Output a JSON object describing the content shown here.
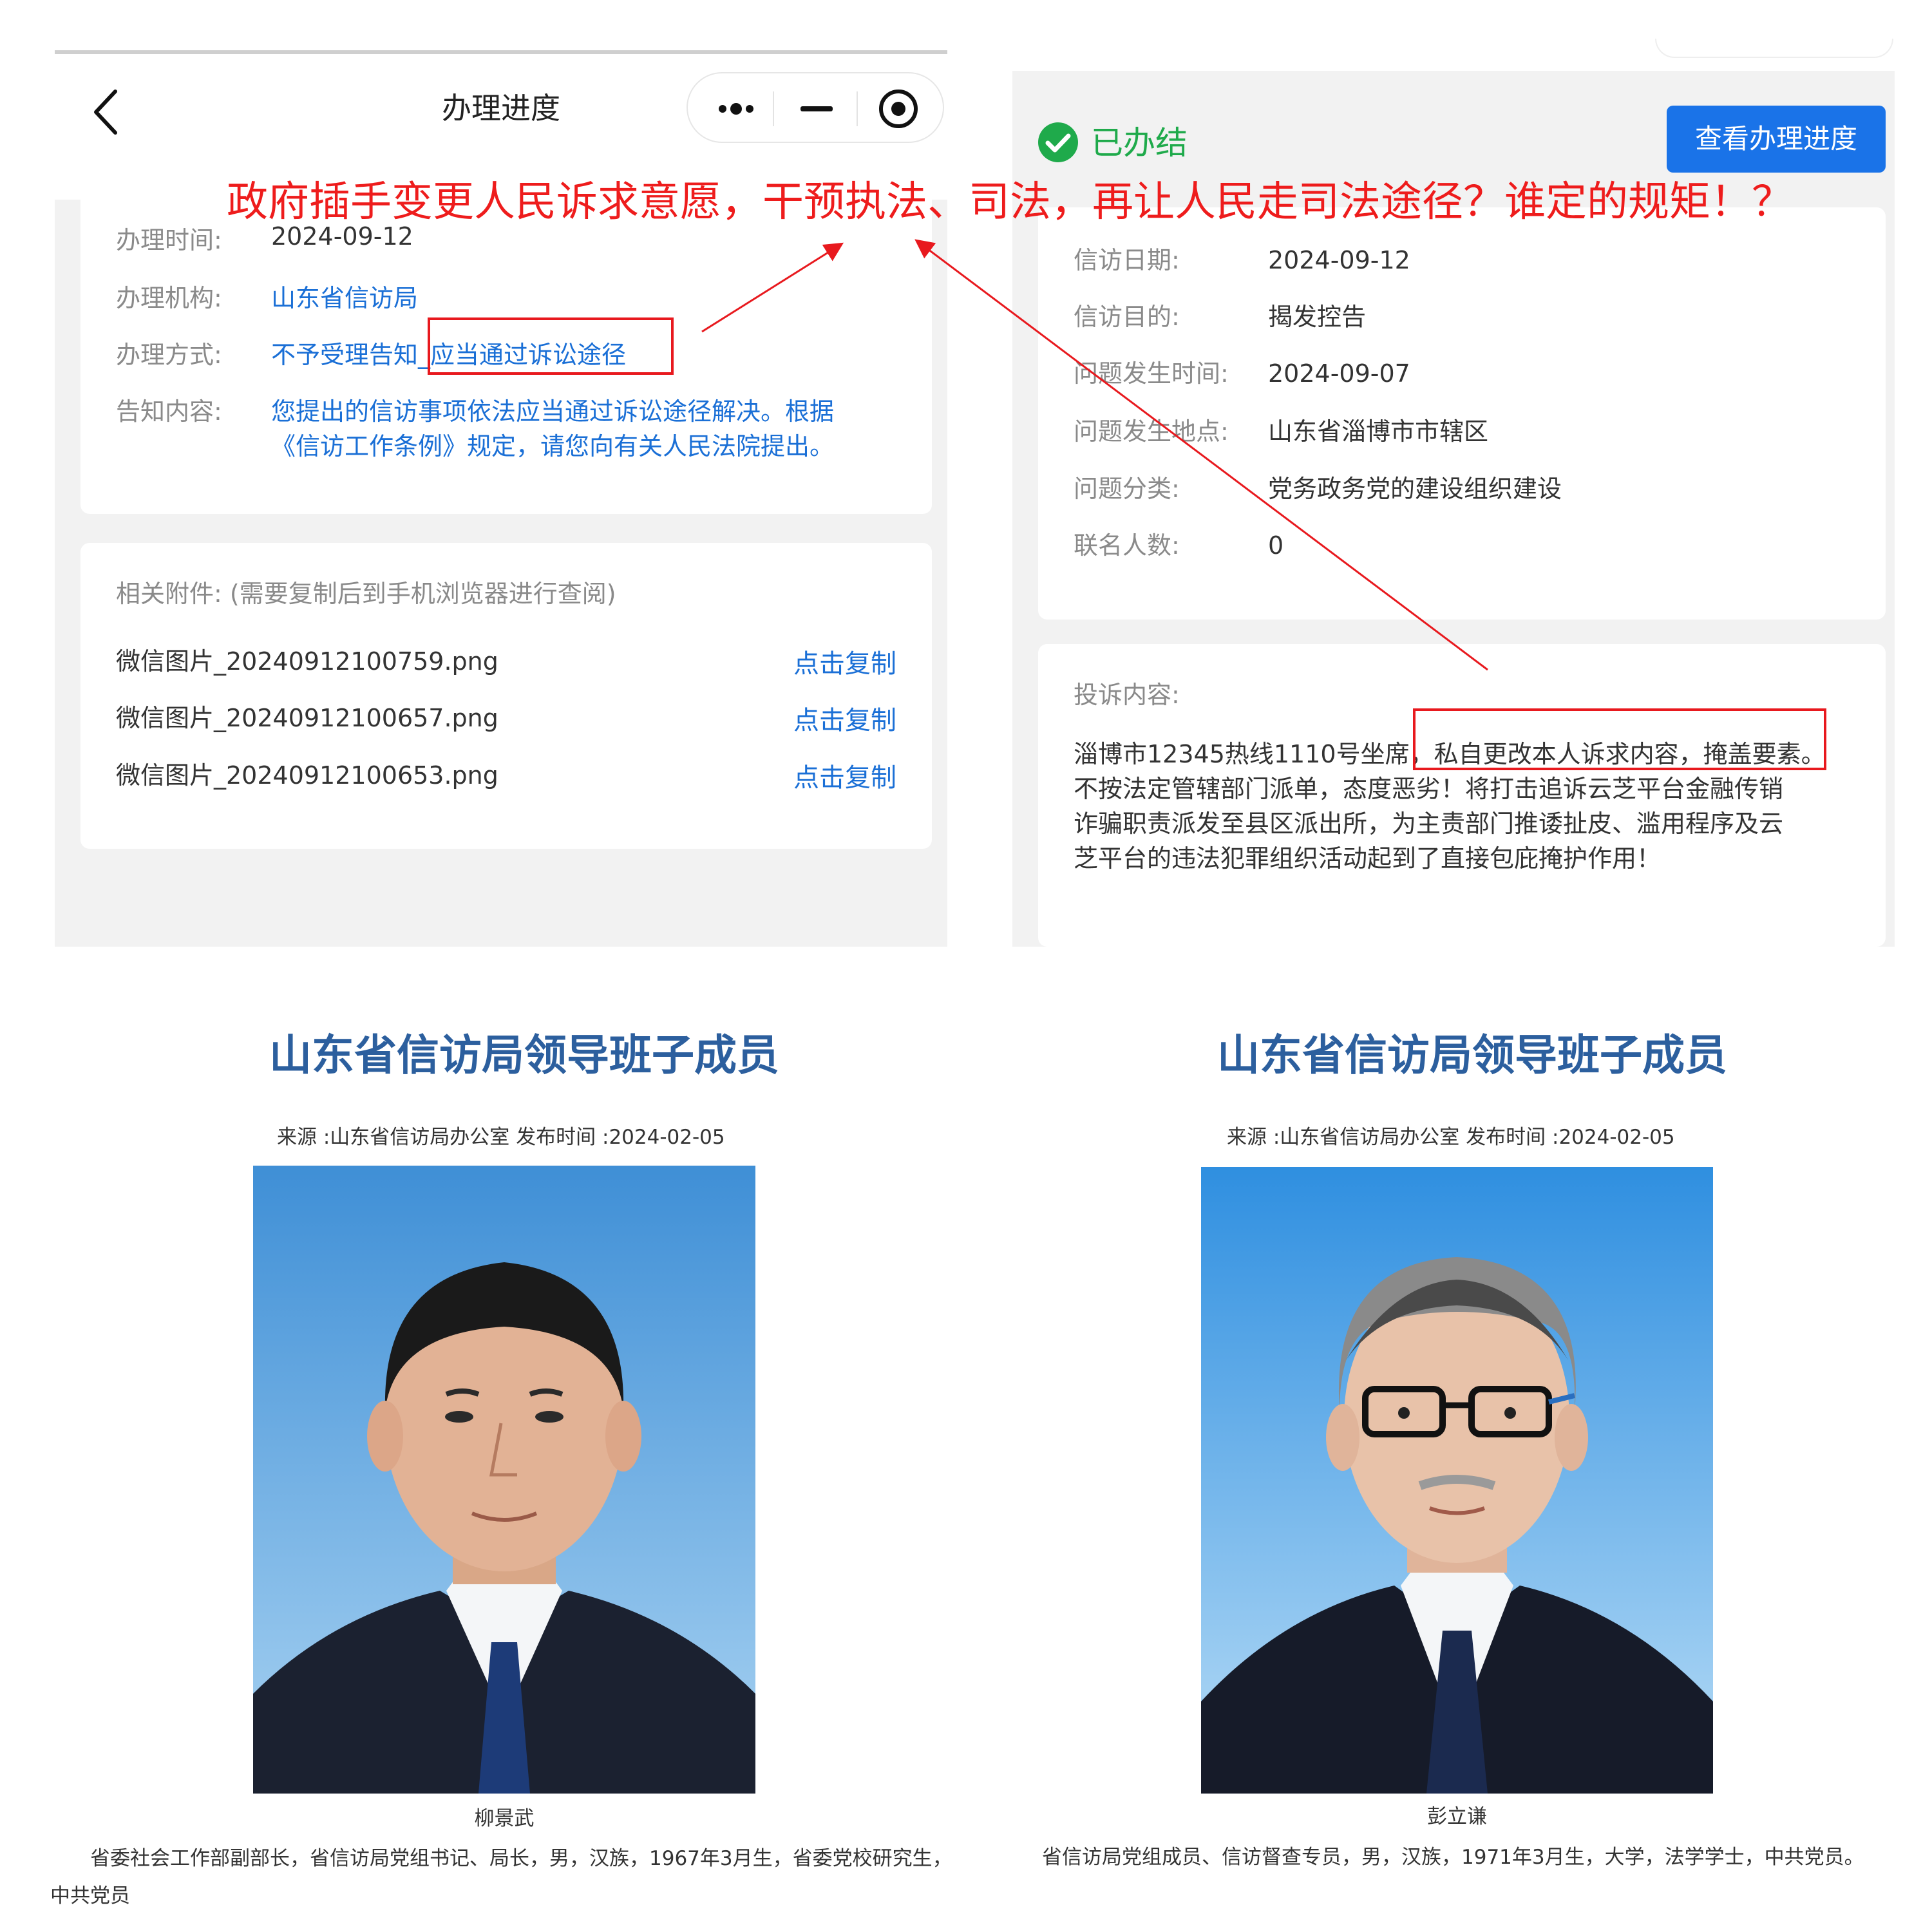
{
  "annotation": {
    "text": "政府插手变更人民诉求意愿，干预执法、司法，再让人民走司法途径？谁定的规矩！？"
  },
  "left_phone": {
    "nav_title": "办理进度",
    "process": {
      "time_label": "办理时间:",
      "time_value": "2024-09-12",
      "org_label": "办理机构:",
      "org_value": "山东省信访局",
      "method_label": "办理方式:",
      "method_value_prefix": "不予受理告知",
      "method_value_highlight": "_应当通过诉讼途径",
      "notice_label": "告知内容:",
      "notice_line1": "您提出的信访事项依法应当通过诉讼途径解决。根据",
      "notice_line2": "《信访工作条例》规定，请您向有关人民法院提出。"
    },
    "attachments": {
      "header": "相关附件:  (需要复制后到手机浏览器进行查阅)",
      "copy_label": "点击复制",
      "files": [
        "微信图片_20240912100759.png",
        "微信图片_20240912100657.png",
        "微信图片_20240912100653.png"
      ]
    }
  },
  "right_phone": {
    "status": "已办结",
    "view_progress_button": "查看办理进度",
    "petition": {
      "date_label": "信访日期:",
      "date_value": "2024-09-12",
      "purpose_label": "信访目的:",
      "purpose_value": "揭发控告",
      "occur_time_label": "问题发生时间:",
      "occur_time_value": "2024-09-07",
      "occur_place_label": "问题发生地点:",
      "occur_place_value": "山东省淄博市市辖区",
      "category_label": "问题分类:",
      "category_value": "党务政务党的建设组织建设",
      "cosigners_label": "联名人数:",
      "cosigners_value": "0"
    },
    "complaint": {
      "label": "投诉内容:",
      "lines": [
        "淄博市12345热线1110号坐席，私自更改本人诉求内容，掩盖要素。",
        "不按法定管辖部门派单，态度恶劣！将打击追诉云芝平台金融传销",
        "诈骗职责派发至县区派出所，为主责部门推诿扯皮、滥用程序及云",
        "芝平台的违法犯罪组织活动起到了直接包庇掩护作用！"
      ]
    }
  },
  "articles": [
    {
      "title": "山东省信访局领导班子成员",
      "meta": "来源 :山东省信访局办公室     发布时间 :2024-02-05",
      "name": "柳景武",
      "bio_line1": "省委社会工作部副部长，省信访局党组书记、局长，男，汉族，1967年3月生，省委党校研究生，",
      "bio_line2": "中共党员"
    },
    {
      "title": "山东省信访局领导班子成员",
      "meta": "来源 :山东省信访局办公室     发布时间 :2024-02-05",
      "name": "彭立谦",
      "bio_line1": "省信访局党组成员、信访督查专员，男，汉族，1971年3月生，大学，法学学士，中共党员。"
    }
  ],
  "colors": {
    "accent_blue": "#1a73e8",
    "link_blue": "#1a6fd6",
    "success_green": "#1faa4b",
    "annotation_red": "#ee1c1c",
    "title_blue": "#2c5f9e"
  }
}
